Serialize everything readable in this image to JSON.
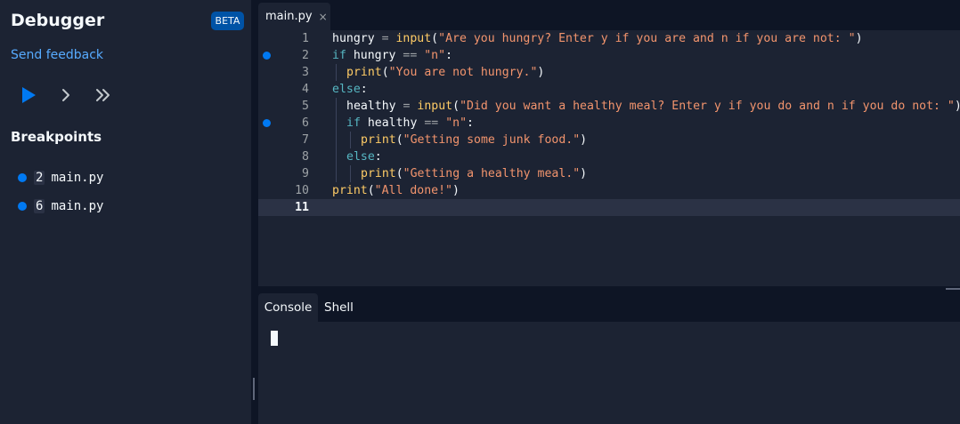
{
  "sidebar": {
    "title": "Debugger",
    "badge": "BETA",
    "feedback_link": "Send feedback",
    "controls": [
      {
        "icon": "play-icon",
        "color": "#0079f2"
      },
      {
        "icon": "step-icon"
      },
      {
        "icon": "continue-icon"
      }
    ],
    "breakpoints_heading": "Breakpoints",
    "breakpoints": [
      {
        "line": "2",
        "file": "main.py"
      },
      {
        "line": "6",
        "file": "main.py"
      }
    ]
  },
  "editor": {
    "tab": {
      "label": "main.py",
      "close": "×"
    },
    "active_line": 11,
    "breakpoint_lines": [
      2,
      6
    ],
    "lines": [
      {
        "num": "1",
        "indent": 0,
        "tokens": [
          [
            "p",
            "hungry "
          ],
          [
            "op",
            "= "
          ],
          [
            "fn",
            "input"
          ],
          [
            "p",
            "("
          ],
          [
            "str",
            "\"Are you hungry? Enter y if you are and n if you are not: \""
          ],
          [
            "p",
            ")"
          ]
        ]
      },
      {
        "num": "2",
        "indent": 0,
        "tokens": [
          [
            "kw",
            "if "
          ],
          [
            "p",
            "hungry "
          ],
          [
            "op",
            "== "
          ],
          [
            "str",
            "\"n\""
          ],
          [
            "p",
            ":"
          ]
        ]
      },
      {
        "num": "3",
        "indent": 1,
        "tokens": [
          [
            "fn",
            "print"
          ],
          [
            "p",
            "("
          ],
          [
            "str",
            "\"You are not hungry.\""
          ],
          [
            "p",
            ")"
          ]
        ]
      },
      {
        "num": "4",
        "indent": 0,
        "tokens": [
          [
            "kw",
            "else"
          ],
          [
            "p",
            ":"
          ]
        ]
      },
      {
        "num": "5",
        "indent": 1,
        "tokens": [
          [
            "p",
            "healthy "
          ],
          [
            "op",
            "= "
          ],
          [
            "fn",
            "input"
          ],
          [
            "p",
            "("
          ],
          [
            "str",
            "\"Did you want a healthy meal? Enter y if you do and n if you do not: \""
          ],
          [
            "p",
            ")"
          ]
        ]
      },
      {
        "num": "6",
        "indent": 1,
        "tokens": [
          [
            "kw",
            "if "
          ],
          [
            "p",
            "healthy "
          ],
          [
            "op",
            "== "
          ],
          [
            "str",
            "\"n\""
          ],
          [
            "p",
            ":"
          ]
        ]
      },
      {
        "num": "7",
        "indent": 2,
        "tokens": [
          [
            "fn",
            "print"
          ],
          [
            "p",
            "("
          ],
          [
            "str",
            "\"Getting some junk food.\""
          ],
          [
            "p",
            ")"
          ]
        ]
      },
      {
        "num": "8",
        "indent": 1,
        "tokens": [
          [
            "kw",
            "else"
          ],
          [
            "p",
            ":"
          ]
        ]
      },
      {
        "num": "9",
        "indent": 2,
        "tokens": [
          [
            "fn",
            "print"
          ],
          [
            "p",
            "("
          ],
          [
            "str",
            "\"Getting a healthy meal.\""
          ],
          [
            "p",
            ")"
          ]
        ]
      },
      {
        "num": "10",
        "indent": 0,
        "tokens": [
          [
            "fn",
            "print"
          ],
          [
            "p",
            "("
          ],
          [
            "str",
            "\"All done!\""
          ],
          [
            "p",
            ")"
          ]
        ]
      },
      {
        "num": "11",
        "indent": 0,
        "tokens": []
      }
    ]
  },
  "bottom": {
    "tabs": [
      {
        "label": "Console",
        "active": true
      },
      {
        "label": "Shell",
        "active": false
      }
    ]
  },
  "colors": {
    "background": "#0e1525",
    "panel": "#1c2333",
    "accent": "#0079f2",
    "link": "#57abff"
  }
}
